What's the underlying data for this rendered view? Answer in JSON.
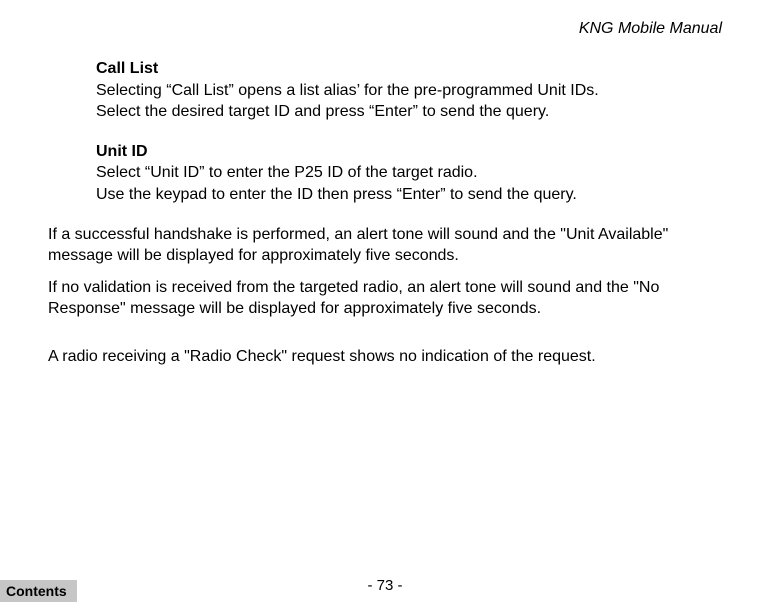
{
  "header": {
    "title": "KNG Mobile Manual"
  },
  "sections": {
    "call_list": {
      "heading": "Call List",
      "line1": "Selecting “Call List” opens a list alias’ for the pre-programmed Unit IDs.",
      "line2": "Select the desired target ID and press “Enter” to send the query."
    },
    "unit_id": {
      "heading": "Unit ID",
      "line1": "Select “Unit ID” to enter the P25 ID of the target radio.",
      "line2": "Use the keypad to enter the ID then press “Enter” to send the query."
    }
  },
  "body": {
    "p1": "If a successful handshake is performed, an alert tone will sound and the \"Unit Available\" message will be displayed for approximately five seconds.",
    "p2": "If no validation is received from the targeted radio, an alert tone will sound and the \"No Response\" message will be displayed for approximately five seconds.",
    "p3": "A radio receiving a \"Radio Check\" request shows no indication of the request."
  },
  "footer": {
    "page_number": "- 73 -",
    "contents_label": "Contents"
  }
}
